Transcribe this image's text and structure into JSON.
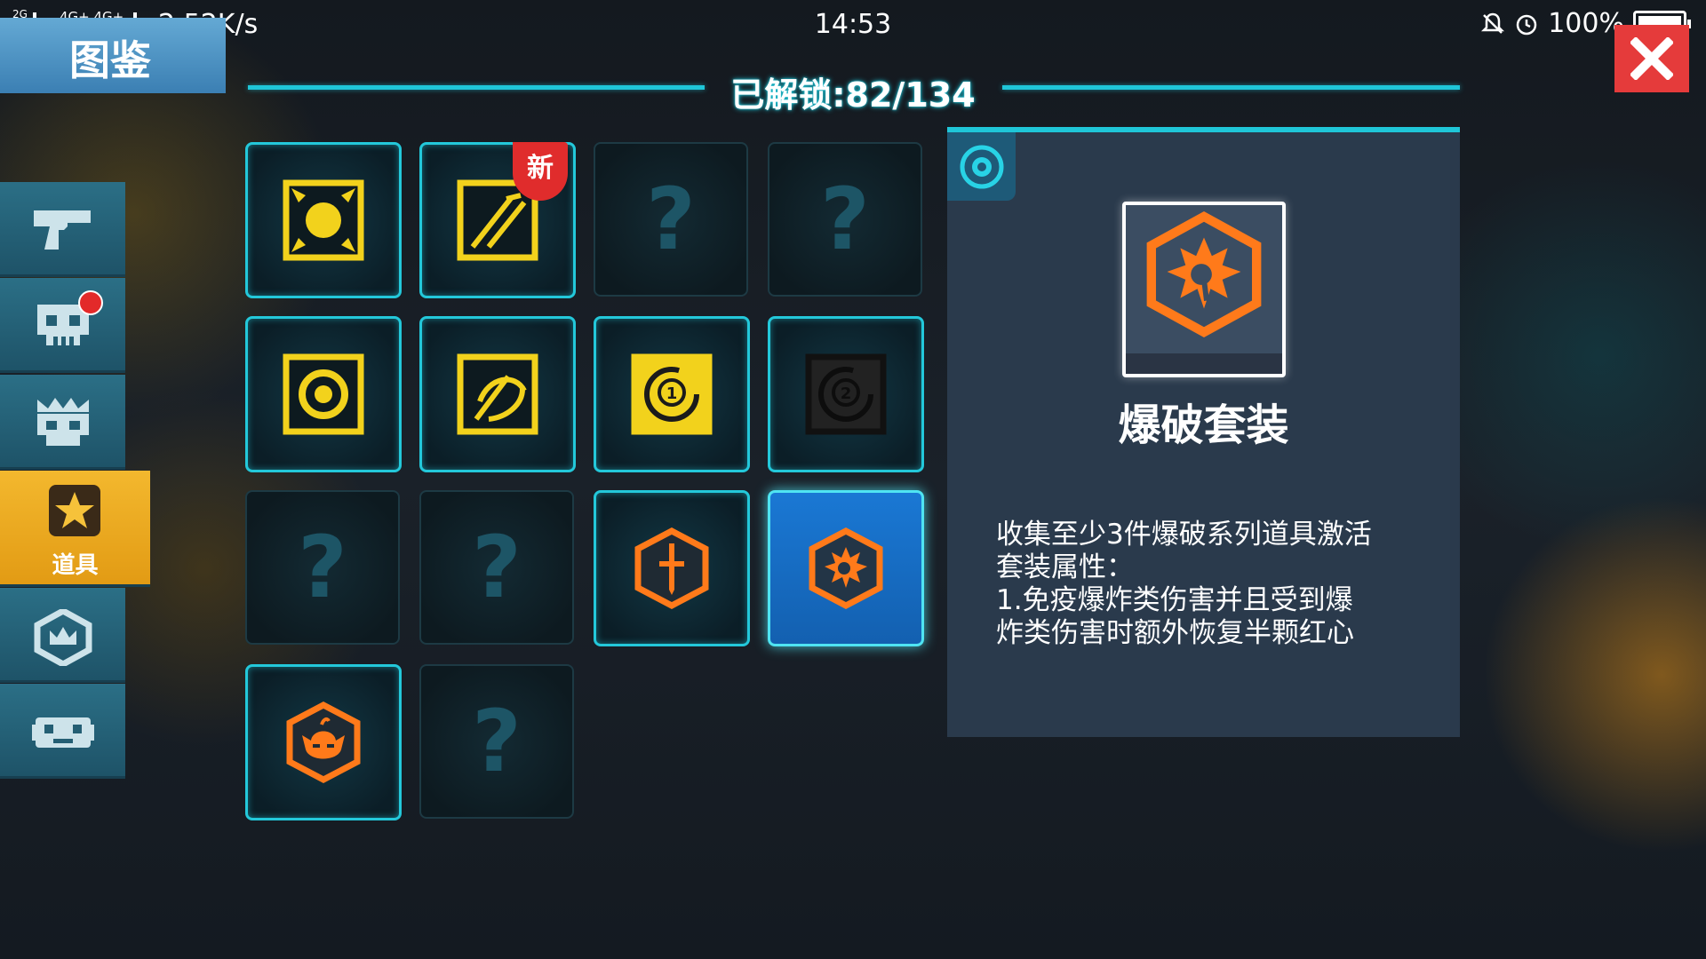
{
  "status_bar": {
    "network": "2G 4G+ 4G+ 2G",
    "speed": "2.52K/s",
    "time": "14:53",
    "battery": "100%"
  },
  "title": "图鉴",
  "unlock_progress": "已解锁:82/134",
  "tabs": [
    {
      "icon": "gun-icon",
      "active": false
    },
    {
      "icon": "skull-icon",
      "active": false,
      "badge": true
    },
    {
      "icon": "crowned-skull-icon",
      "active": false
    },
    {
      "icon": "star-icon",
      "active": true,
      "label": "道具"
    },
    {
      "icon": "crown-badge-icon",
      "active": false
    },
    {
      "icon": "robot-face-icon",
      "active": false
    }
  ],
  "new_badge": "新",
  "locked_symbol": "?",
  "grid_items": [
    {
      "state": "unlocked",
      "icon": "sun-icon",
      "color": "yellow"
    },
    {
      "state": "unlocked",
      "icon": "slash-icon",
      "color": "yellow",
      "new": true
    },
    {
      "state": "locked"
    },
    {
      "state": "locked"
    },
    {
      "state": "unlocked",
      "icon": "ring-icon",
      "color": "yellow"
    },
    {
      "state": "unlocked",
      "icon": "swirl-icon",
      "color": "yellow"
    },
    {
      "state": "unlocked",
      "icon": "clock-one-icon",
      "color": "yellow"
    },
    {
      "state": "unlocked",
      "icon": "clock-two-icon",
      "color": "black"
    },
    {
      "state": "locked"
    },
    {
      "state": "locked"
    },
    {
      "state": "unlocked",
      "icon": "sword-hex-icon",
      "color": "orange"
    },
    {
      "state": "selected",
      "icon": "blast-hex-icon",
      "color": "orange"
    },
    {
      "state": "unlocked",
      "icon": "demon-hex-icon",
      "color": "orange"
    },
    {
      "state": "locked"
    }
  ],
  "detail": {
    "corner_icon": "target-icon",
    "icon": "blast-hex-icon",
    "name": "爆破套装",
    "description": "收集至少3件爆破系列道具激活\n套装属性：\n1.免疫爆炸类伤害并且受到爆\n炸类伤害时额外恢复半颗红心"
  },
  "colors": {
    "accent": "#1fc6d8",
    "tab": "#2b6f86",
    "active_tab": "#f3b82e",
    "close": "#e53b3b",
    "icon_yellow": "#f2d21c",
    "icon_orange": "#ff7a1a",
    "selected": "#1a78d4"
  }
}
